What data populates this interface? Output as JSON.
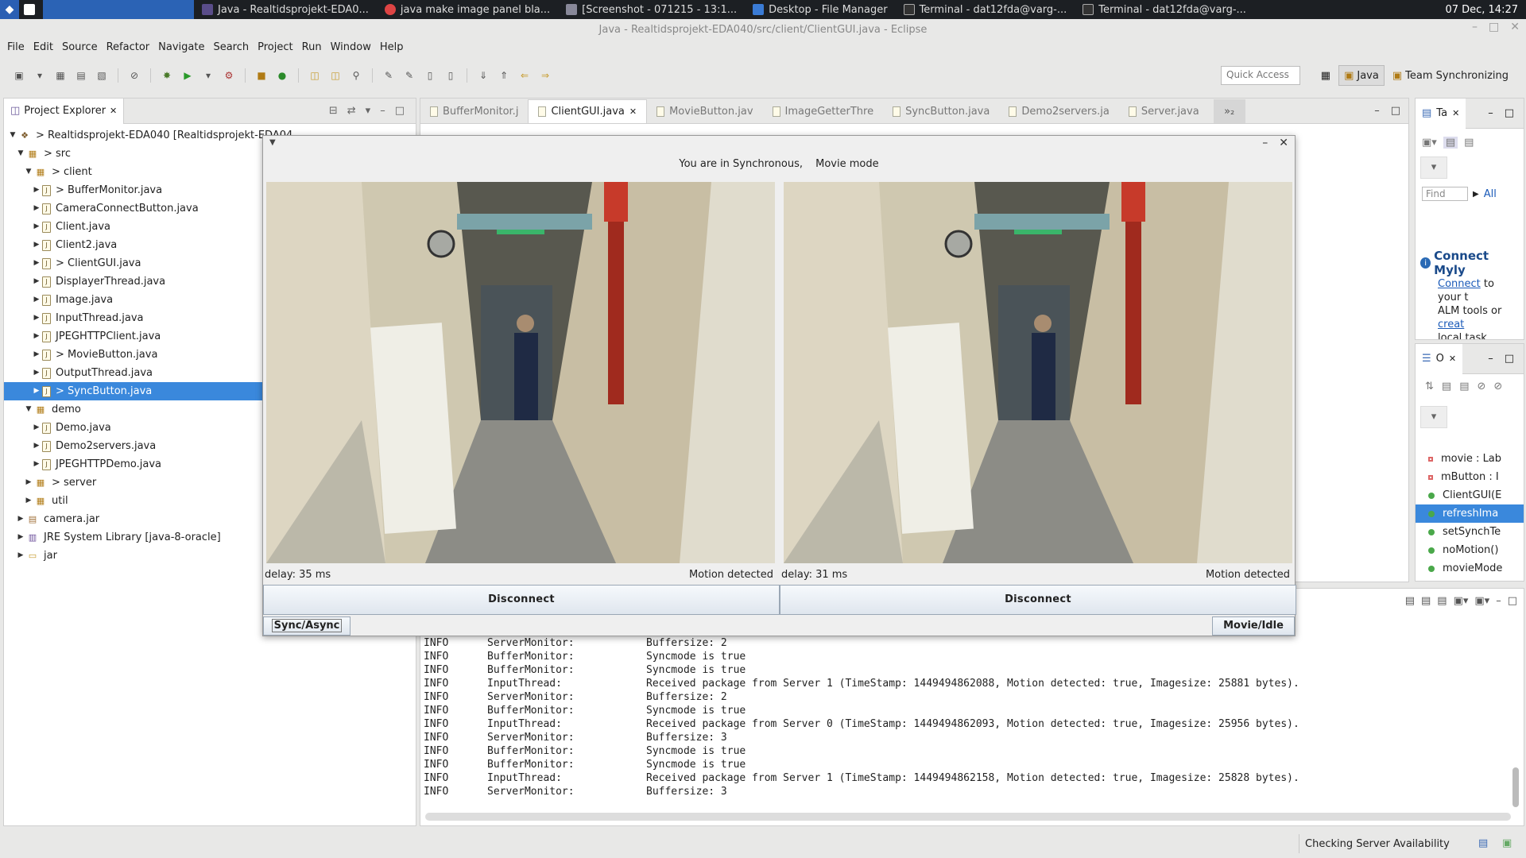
{
  "taskbar": {
    "items": [
      "Java - Realtidsprojekt-EDA0...",
      "java make image panel bla...",
      "[Screenshot - 071215 - 13:1...",
      "Desktop - File Manager",
      "Terminal - dat12fda@varg-...",
      "Terminal - dat12fda@varg-..."
    ],
    "clock": "07 Dec, 14:27"
  },
  "window_title": "Java - Realtidsprojekt-EDA040/src/client/ClientGUI.java - Eclipse",
  "menu": [
    "File",
    "Edit",
    "Source",
    "Refactor",
    "Navigate",
    "Search",
    "Project",
    "Run",
    "Window",
    "Help"
  ],
  "toolbar": {
    "quick_access_placeholder": "Quick Access",
    "perspectives": [
      "Java",
      "Team Synchronizing"
    ]
  },
  "project_explorer": {
    "title": "Project Explorer",
    "tree": [
      {
        "label": "> Realtidsprojekt-EDA040  [Realtidsprojekt-EDA04",
        "level": 0,
        "arrow": "down",
        "icon": "project"
      },
      {
        "label": "> src",
        "level": 1,
        "arrow": "down",
        "icon": "package"
      },
      {
        "label": "> client",
        "level": 2,
        "arrow": "down",
        "icon": "package"
      },
      {
        "label": "> BufferMonitor.java",
        "level": 3,
        "arrow": "right",
        "icon": "file"
      },
      {
        "label": "CameraConnectButton.java",
        "level": 3,
        "arrow": "right",
        "icon": "file"
      },
      {
        "label": "Client.java",
        "level": 3,
        "arrow": "right",
        "icon": "file"
      },
      {
        "label": "Client2.java",
        "level": 3,
        "arrow": "right",
        "icon": "file"
      },
      {
        "label": "> ClientGUI.java",
        "level": 3,
        "arrow": "right",
        "icon": "file"
      },
      {
        "label": "DisplayerThread.java",
        "level": 3,
        "arrow": "right",
        "icon": "file"
      },
      {
        "label": "Image.java",
        "level": 3,
        "arrow": "right",
        "icon": "file"
      },
      {
        "label": "InputThread.java",
        "level": 3,
        "arrow": "right",
        "icon": "file"
      },
      {
        "label": "JPEGHTTPClient.java",
        "level": 3,
        "arrow": "right",
        "icon": "file"
      },
      {
        "label": "> MovieButton.java",
        "level": 3,
        "arrow": "right",
        "icon": "file"
      },
      {
        "label": "OutputThread.java",
        "level": 3,
        "arrow": "right",
        "icon": "file"
      },
      {
        "label": "> SyncButton.java",
        "level": 3,
        "arrow": "right",
        "icon": "file",
        "selected": true
      },
      {
        "label": "demo",
        "level": 2,
        "arrow": "down",
        "icon": "package"
      },
      {
        "label": "Demo.java",
        "level": 3,
        "arrow": "right",
        "icon": "file"
      },
      {
        "label": "Demo2servers.java",
        "level": 3,
        "arrow": "right",
        "icon": "file"
      },
      {
        "label": "JPEGHTTPDemo.java",
        "level": 3,
        "arrow": "right",
        "icon": "file"
      },
      {
        "label": "> server",
        "level": 2,
        "arrow": "right",
        "icon": "package"
      },
      {
        "label": "util",
        "level": 2,
        "arrow": "right",
        "icon": "package"
      },
      {
        "label": "camera.jar",
        "level": 1,
        "arrow": "right",
        "icon": "jar"
      },
      {
        "label": "JRE System Library [java-8-oracle]",
        "level": 1,
        "arrow": "right",
        "icon": "library"
      },
      {
        "label": "jar",
        "level": 1,
        "arrow": "right",
        "icon": "folder"
      }
    ]
  },
  "editor_tabs": [
    {
      "label": "BufferMonitor.j",
      "active": false
    },
    {
      "label": "ClientGUI.java",
      "active": true
    },
    {
      "label": "MovieButton.jav",
      "active": false
    },
    {
      "label": "ImageGetterThre",
      "active": false
    },
    {
      "label": "SyncButton.java",
      "active": false
    },
    {
      "label": "Demo2servers.ja",
      "active": false
    },
    {
      "label": "Server.java",
      "active": false
    }
  ],
  "editor_more_count": "»₂",
  "task_panel": {
    "tab": "Ta",
    "find_placeholder": "Find",
    "all_label": "All",
    "connect_title": "Connect Myly",
    "connect_link": "Connect",
    "connect_text1": "to your t",
    "connect_text2": "ALM tools or",
    "connect_link2": "creat",
    "connect_text3": "local task."
  },
  "outline_panel": {
    "tab": "O",
    "items": [
      {
        "label": "movie : Lab",
        "kind": "field"
      },
      {
        "label": "mButton : I",
        "kind": "field"
      },
      {
        "label": "ClientGUI(E",
        "kind": "constructor"
      },
      {
        "label": "refreshIma",
        "kind": "method",
        "selected": true
      },
      {
        "label": "setSynchTe",
        "kind": "method"
      },
      {
        "label": "noMotion()",
        "kind": "method"
      },
      {
        "label": "movieMode",
        "kind": "method"
      }
    ]
  },
  "console": {
    "lines": [
      {
        "level": "INFO",
        "source": "ServerMonitor:",
        "message": "Buffersize: 2"
      },
      {
        "level": "INFO",
        "source": "BufferMonitor:",
        "message": "Syncmode is true"
      },
      {
        "level": "INFO",
        "source": "BufferMonitor:",
        "message": "Syncmode is true"
      },
      {
        "level": "INFO",
        "source": "InputThread:",
        "message": "Received package from Server 1 (TimeStamp: 1449494862088, Motion detected: true, Imagesize: 25881 bytes)."
      },
      {
        "level": "INFO",
        "source": "ServerMonitor:",
        "message": "Buffersize: 2"
      },
      {
        "level": "INFO",
        "source": "BufferMonitor:",
        "message": "Syncmode is true"
      },
      {
        "level": "INFO",
        "source": "InputThread:",
        "message": "Received package from Server 0 (TimeStamp: 1449494862093, Motion detected: true, Imagesize: 25956 bytes)."
      },
      {
        "level": "INFO",
        "source": "ServerMonitor:",
        "message": "Buffersize: 3"
      },
      {
        "level": "INFO",
        "source": "BufferMonitor:",
        "message": "Syncmode is true"
      },
      {
        "level": "INFO",
        "source": "BufferMonitor:",
        "message": "Syncmode is true"
      },
      {
        "level": "INFO",
        "source": "InputThread:",
        "message": "Received package from Server 1 (TimeStamp: 1449494862158, Motion detected: true, Imagesize: 25828 bytes)."
      },
      {
        "level": "INFO",
        "source": "ServerMonitor:",
        "message": "Buffersize: 3"
      }
    ]
  },
  "status_bar": {
    "text": "Checking Server Availability"
  },
  "client_window": {
    "mode_text_1": "You are in Synchronous,",
    "mode_text_2": "Movie mode",
    "camera1": {
      "delay": "delay: 35 ms",
      "motion": "Motion detected"
    },
    "camera2": {
      "delay": "delay: 31 ms",
      "motion": "Motion detected"
    },
    "disconnect_label": "Disconnect",
    "sync_button": "Sync/Async",
    "movie_button": "Movie/Idle"
  }
}
